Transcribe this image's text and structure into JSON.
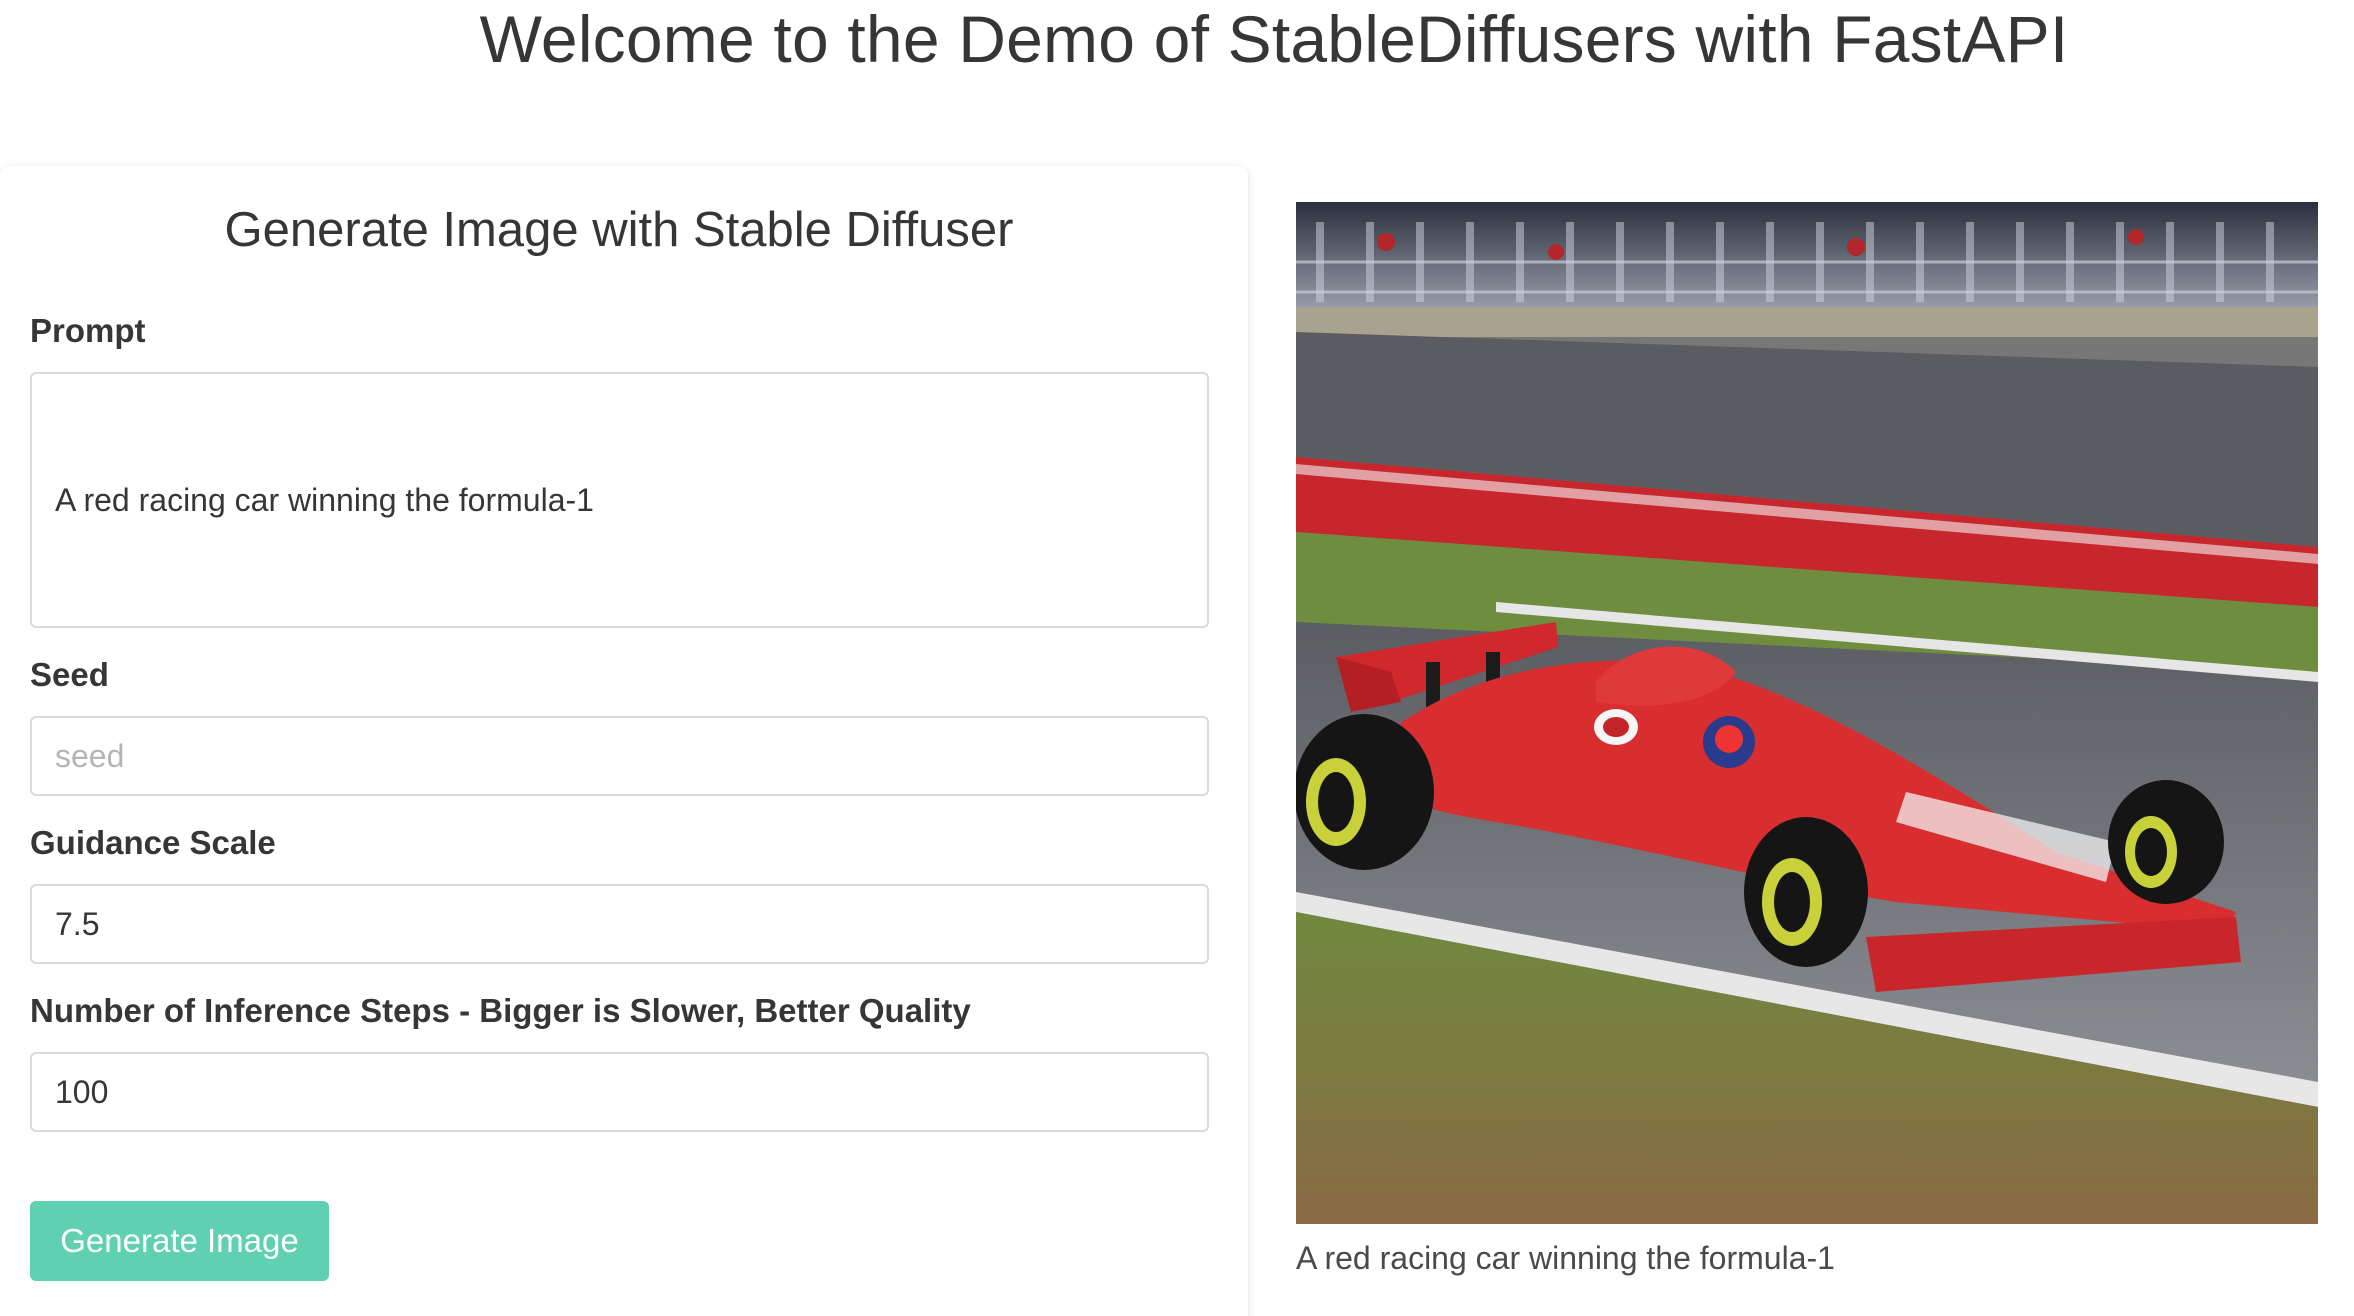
{
  "page": {
    "title": "Welcome to the Demo of StableDiffusers with FastAPI"
  },
  "form": {
    "title": "Generate Image with Stable Diffuser",
    "prompt": {
      "label": "Prompt",
      "value": "A red racing car winning the formula-1"
    },
    "seed": {
      "label": "Seed",
      "placeholder": "seed",
      "value": ""
    },
    "guidance_scale": {
      "label": "Guidance Scale",
      "value": "7.5"
    },
    "inference_steps": {
      "label": "Number of Inference Steps - Bigger is Slower, Better Quality",
      "value": "100"
    },
    "submit_label": "Generate Image"
  },
  "result": {
    "caption": "A red racing car winning the formula-1"
  },
  "colors": {
    "button": "#5fd1b0",
    "text": "#363636",
    "border": "#dbdbdb"
  }
}
